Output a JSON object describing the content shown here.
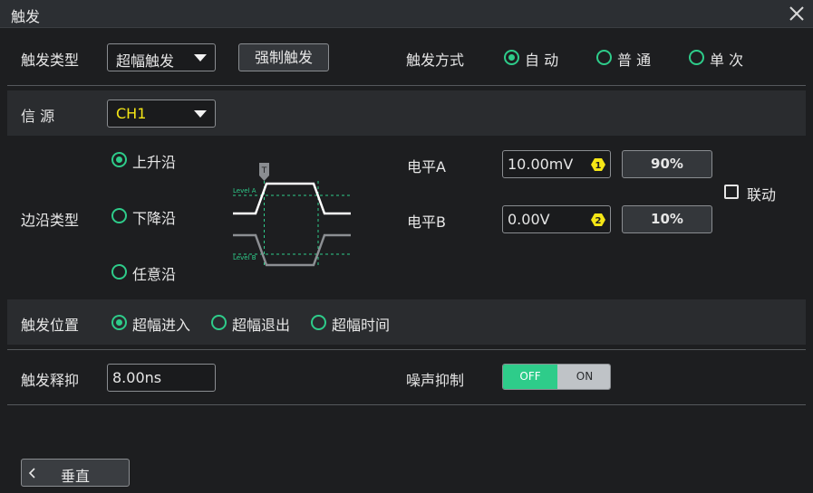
{
  "window": {
    "title": "触发"
  },
  "trigger_type": {
    "label": "触发类型",
    "value": "超幅触发"
  },
  "force_trigger": {
    "label": "强制触发"
  },
  "sweep": {
    "label": "触发方式",
    "options": [
      {
        "label": "自 动",
        "selected": true
      },
      {
        "label": "普 通",
        "selected": false
      },
      {
        "label": "单 次",
        "selected": false
      }
    ]
  },
  "source": {
    "label": "信 源",
    "value": "CH1",
    "value_color": "#f5e616"
  },
  "edge_type": {
    "label": "边沿类型",
    "options": [
      {
        "label": "上升沿",
        "selected": true
      },
      {
        "label": "下降沿",
        "selected": false
      },
      {
        "label": "任意沿",
        "selected": false
      }
    ]
  },
  "diagram": {
    "marker": "T",
    "level_a": "Level A",
    "level_b": "Level B"
  },
  "level_a": {
    "label": "电平A",
    "value": "10.00mV",
    "badge": "1",
    "percent": "90%"
  },
  "level_b": {
    "label": "电平B",
    "value": "0.00V",
    "badge": "2",
    "percent": "10%"
  },
  "linked": {
    "label": "联动",
    "checked": false
  },
  "trigger_position": {
    "label": "触发位置",
    "options": [
      {
        "label": "超幅进入",
        "selected": true
      },
      {
        "label": "超幅退出",
        "selected": false
      },
      {
        "label": "超幅时间",
        "selected": false
      }
    ]
  },
  "holdoff": {
    "label": "触发释抑",
    "value": "8.00ns"
  },
  "noise_reject": {
    "label": "噪声抑制",
    "off_label": "OFF",
    "on_label": "ON",
    "state": "OFF"
  },
  "back": {
    "label": "垂直"
  },
  "colors": {
    "accent": "#2ecc8a",
    "badge": "#f5e616",
    "source": "#f5e616"
  }
}
